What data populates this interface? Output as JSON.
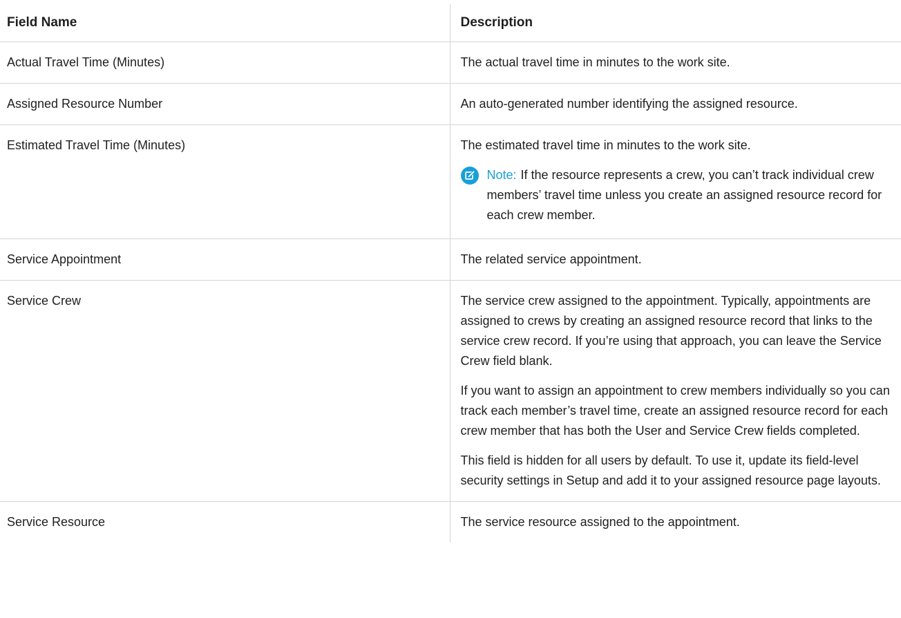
{
  "table": {
    "headers": {
      "field_name": "Field Name",
      "description": "Description"
    },
    "rows": [
      {
        "field": "Actual Travel Time (Minutes)",
        "paragraphs": [
          "The actual travel time in minutes to the work site."
        ]
      },
      {
        "field": "Assigned Resource Number",
        "paragraphs": [
          "An auto-generated number identifying the assigned resource."
        ]
      },
      {
        "field": "Estimated Travel Time (Minutes)",
        "paragraphs": [
          "The estimated travel time in minutes to the work site."
        ],
        "note": {
          "icon": "note-edit-icon",
          "label": "Note:",
          "text": "If the resource represents a crew, you can’t track individual crew members’ travel time unless you create an assigned resource record for each crew member."
        }
      },
      {
        "field": "Service Appointment",
        "paragraphs": [
          "The related service appointment."
        ]
      },
      {
        "field": "Service Crew",
        "paragraphs": [
          "The service crew assigned to the appointment. Typically, appointments are assigned to crews by creating an assigned resource record that links to the service crew record. If you’re using that approach, you can leave the Service Crew field blank.",
          "If you want to assign an appointment to crew members individually so you can track each member’s travel time, create an assigned resource record for each crew member that has both the User and Service Crew fields completed.",
          "This field is hidden for all users by default. To use it, update its field-level security settings in Setup and add it to your assigned resource page layouts."
        ]
      },
      {
        "field": "Service Resource",
        "paragraphs": [
          "The service resource assigned to the appointment."
        ]
      }
    ]
  },
  "colors": {
    "note_accent": "#1a9fd9",
    "border": "#d4d4d4",
    "text": "#1f1f1f"
  }
}
